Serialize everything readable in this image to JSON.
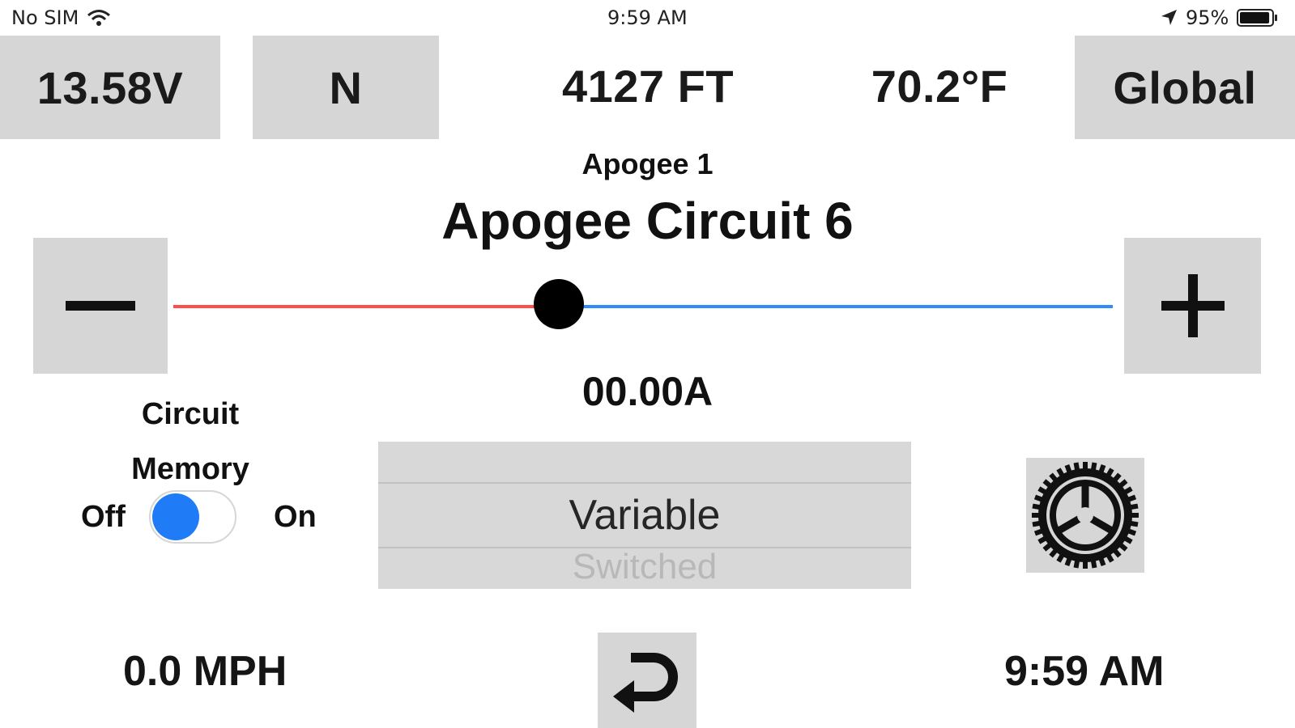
{
  "status_bar": {
    "carrier": "No SIM",
    "time": "9:59 AM",
    "battery_percent": "95%",
    "battery_level": 0.95,
    "icons": [
      "wifi-icon",
      "location-arrow-icon",
      "battery-icon"
    ]
  },
  "top_bar": {
    "voltage": "13.58V",
    "heading": "N",
    "altitude": "4127 FT",
    "temperature": "70.2°F",
    "mode": "Global"
  },
  "circuit": {
    "group": "Apogee 1",
    "name": "Apogee Circuit 6",
    "current": "00.00A",
    "level": 0.41
  },
  "controls": {
    "decrease_icon": "minus-icon",
    "increase_icon": "plus-icon",
    "settings_icon": "gear-icon",
    "back_icon": "return-arrow-icon"
  },
  "memory": {
    "label_line1": "Circuit",
    "label_line2": "Memory",
    "off_label": "Off",
    "on_label": "On",
    "enabled": false
  },
  "picker": {
    "selected": "Variable",
    "next": "Switched"
  },
  "bottom_bar": {
    "speed": "0.0 MPH",
    "clock": "9:59 AM"
  },
  "colors": {
    "tile_gray": "#d6d6d6",
    "slider_min": "#ff4d4d",
    "slider_max": "#2f8cf8",
    "toggle_blue": "#1f7cf6"
  }
}
